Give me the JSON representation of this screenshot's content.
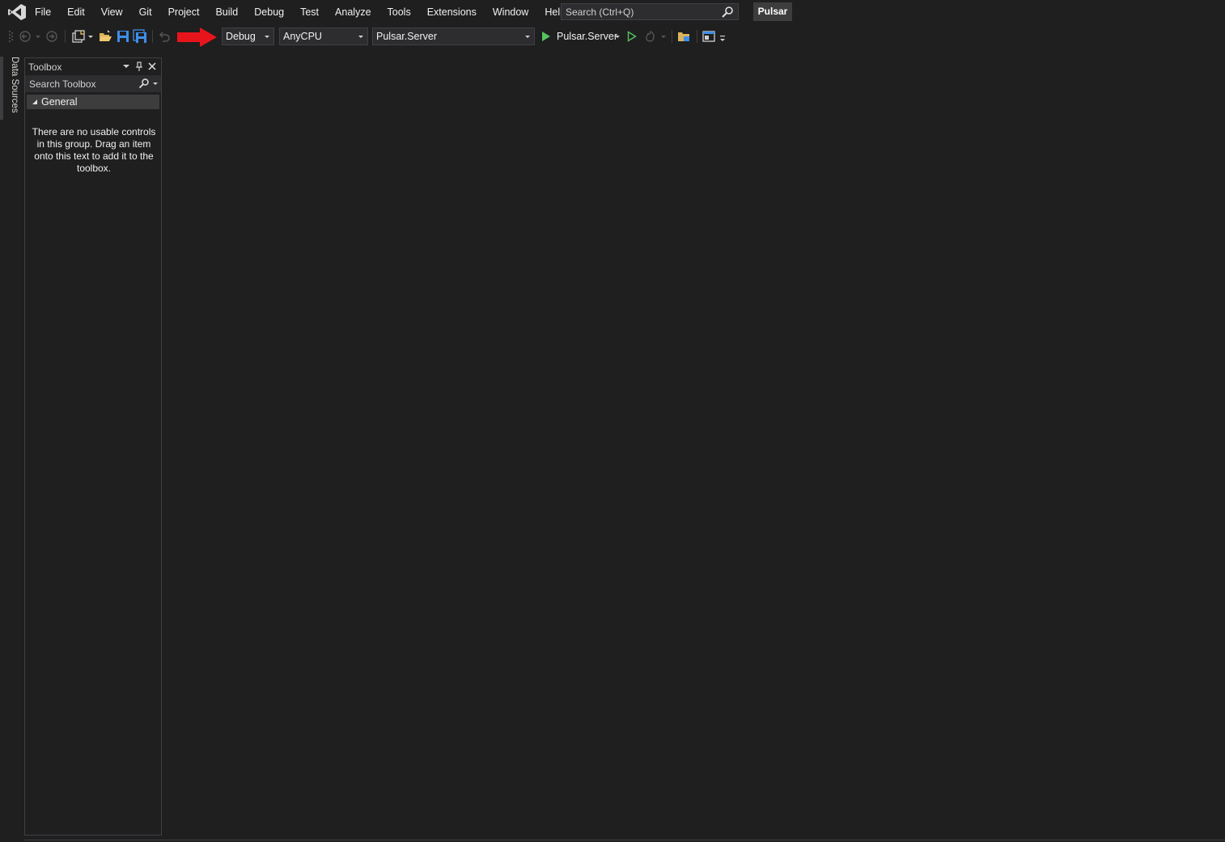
{
  "menu": {
    "items": [
      "File",
      "Edit",
      "View",
      "Git",
      "Project",
      "Build",
      "Debug",
      "Test",
      "Analyze",
      "Tools",
      "Extensions",
      "Window",
      "Help"
    ]
  },
  "search": {
    "placeholder": "Search (Ctrl+Q)"
  },
  "solution_name": "Pulsar",
  "toolbar": {
    "configuration": "Debug",
    "platform": "AnyCPU",
    "startup_project": "Pulsar.Server",
    "start_label": "Pulsar.Server"
  },
  "colors": {
    "background": "#1f1f1f",
    "accent_purple": "#9b6fd6",
    "play_green": "#55c35f",
    "save_blue": "#3f8fe8",
    "folder_yellow": "#dcb35c",
    "annotation_red": "#e8141c"
  },
  "side_tabs": [
    "Data Sources"
  ],
  "toolbox": {
    "title": "Toolbox",
    "search_placeholder": "Search Toolbox",
    "group": "General",
    "empty_message": "There are no usable controls in this group. Drag an item onto this text to add it to the toolbox."
  }
}
